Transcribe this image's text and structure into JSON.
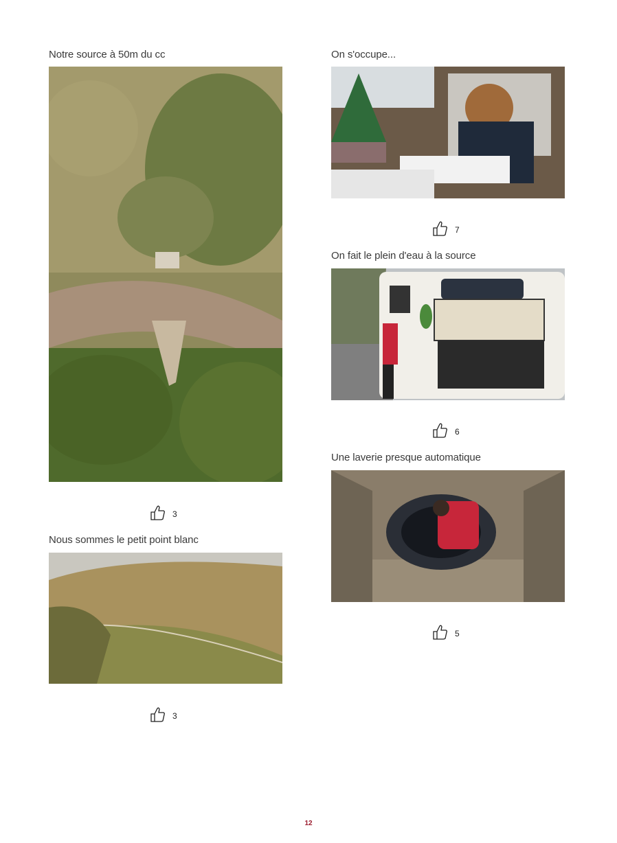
{
  "page": {
    "number": "12",
    "accent_color": "#9b1c2e"
  },
  "posts": [
    {
      "caption": "Notre source à 50m du cc",
      "likes": "3",
      "image": "aerial-road-spring"
    },
    {
      "caption": "Nous sommes le petit point blanc",
      "likes": "3",
      "image": "mountain-landscape"
    },
    {
      "caption": "On s'occupe...",
      "likes": "7",
      "image": "child-homework-camper"
    },
    {
      "caption": "On fait le plein d'eau à la source",
      "likes": "6",
      "image": "camper-water-fill"
    },
    {
      "caption": "Une laverie presque automatique",
      "likes": "5",
      "image": "culvert-laundry"
    }
  ],
  "icons": {
    "like": "thumbs-up-icon"
  }
}
